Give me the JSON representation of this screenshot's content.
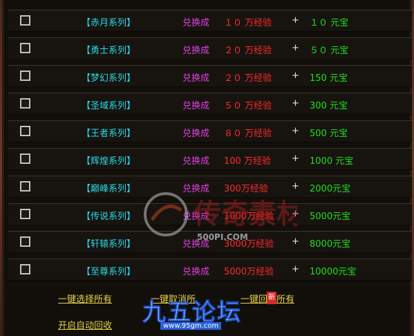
{
  "rows": [
    {
      "series": "【赤月系列】",
      "exchange": "兑换成",
      "exp": "１０ 万经验",
      "plus": "+",
      "yuanbao": "１０ 元宝"
    },
    {
      "series": "【勇士系列】",
      "exchange": "兑换成",
      "exp": "２０ 万经验",
      "plus": "+",
      "yuanbao": "５０ 元宝"
    },
    {
      "series": "【梦幻系列】",
      "exchange": "兑换成",
      "exp": "２０ 万经验",
      "plus": "+",
      "yuanbao": "150 元宝"
    },
    {
      "series": "【圣域系列】",
      "exchange": "兑换成",
      "exp": "５０ 万经验",
      "plus": "+",
      "yuanbao": "300 元宝"
    },
    {
      "series": "【王者系列】",
      "exchange": "兑换成",
      "exp": "８０ 万经验",
      "plus": "+",
      "yuanbao": "500 元宝"
    },
    {
      "series": "【辉煌系列】",
      "exchange": "兑换成",
      "exp": "100 万经验",
      "plus": "+",
      "yuanbao": "1000 元宝"
    },
    {
      "series": "【巅峰系列】",
      "exchange": "兑换成",
      "exp": "300万经验",
      "plus": "+",
      "yuanbao": "2000元宝"
    },
    {
      "series": "【传说系列】",
      "exchange": "兑换成",
      "exp": "1000万经验",
      "plus": "+",
      "yuanbao": "5000元宝"
    },
    {
      "series": "【轩辕系列】",
      "exchange": "兑换成",
      "exp": "3000万经验",
      "plus": "+",
      "yuanbao": "8000元宝"
    },
    {
      "series": "【至尊系列】",
      "exchange": "兑换成",
      "exp": "5000万经验",
      "plus": "+",
      "yuanbao": "10000元宝"
    }
  ],
  "actions": {
    "select_all": "一键选择所有",
    "cancel_all": "一键取消所",
    "recycle_all": "一键回收所有",
    "auto_recycle": "开启自动回收"
  },
  "watermark": {
    "site": "500PI.COM"
  },
  "logo": {
    "text": "九五论坛",
    "url": "www.95gm.com",
    "badge": "新"
  }
}
